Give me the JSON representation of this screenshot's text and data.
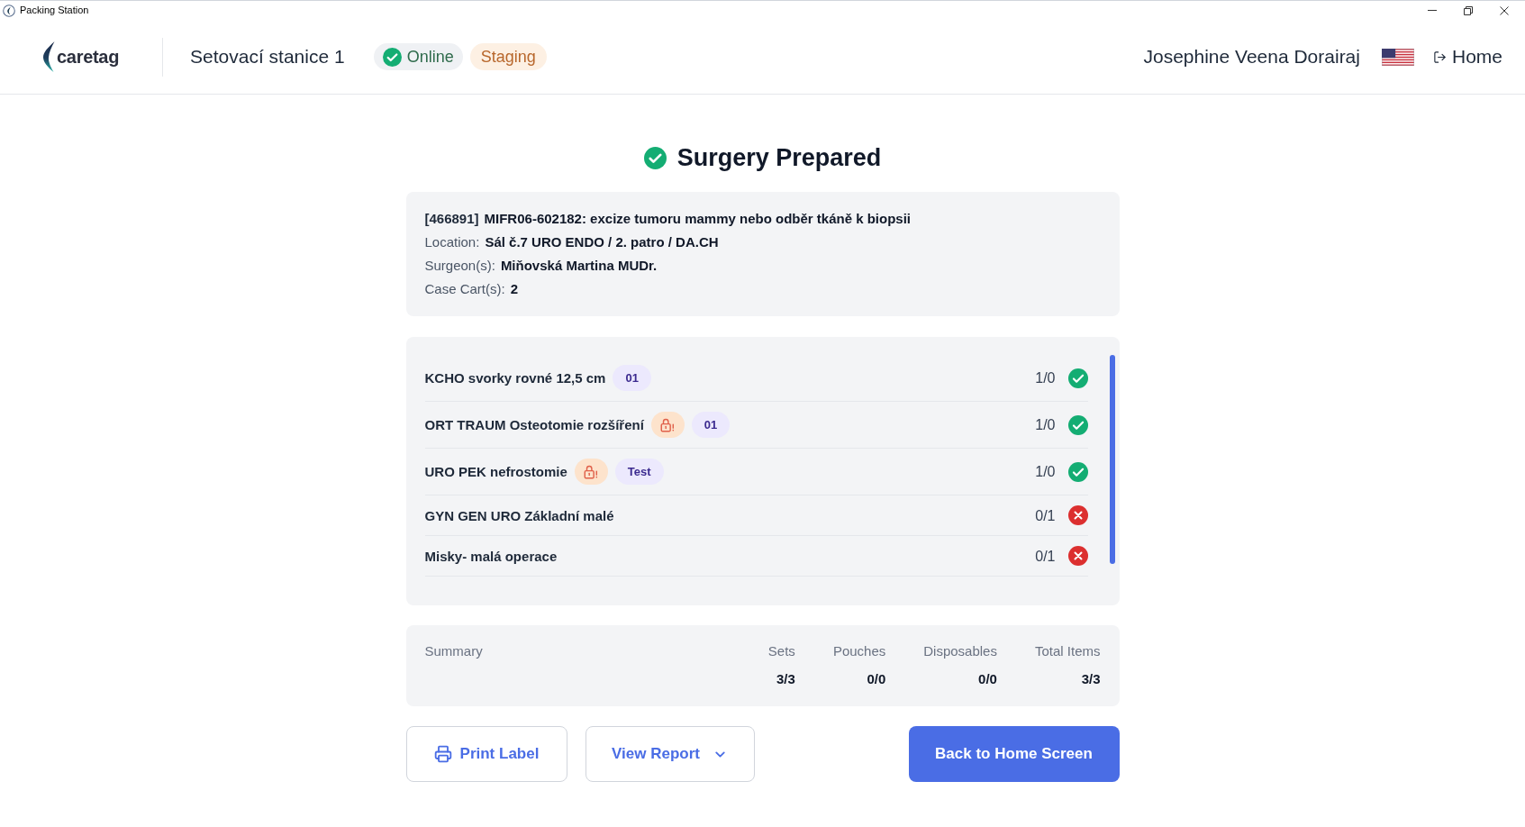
{
  "window": {
    "title": "Packing Station"
  },
  "header": {
    "logo": "caretag",
    "station": "Setovací stanice 1",
    "badges": [
      {
        "kind": "online",
        "label": "Online"
      },
      {
        "kind": "environment",
        "label": "Staging"
      }
    ],
    "user": "Josephine Veena Dorairaj",
    "home_link": "Home"
  },
  "heading": "Surgery Prepared",
  "case": {
    "id": "[466891]",
    "title": "MIFR06-602182: excize tumoru mammy nebo odběr tkáně k biopsii",
    "fields": [
      {
        "label": "Location:",
        "value": "Sál č.7 URO ENDO / 2. patro / DA.CH"
      },
      {
        "label": "Surgeon(s):",
        "value": "Miňovská Martina MUDr."
      },
      {
        "label": "Case Cart(s):",
        "value": "2"
      }
    ]
  },
  "items": [
    {
      "name": "KCHO svorky rovné 12,5 cm",
      "locked": false,
      "tag": "01",
      "count": "1/0",
      "complete": true
    },
    {
      "name": "ORT TRAUM Osteotomie rozšíření",
      "locked": true,
      "tag": "01",
      "count": "1/0",
      "complete": true
    },
    {
      "name": "URO PEK nefrostomie",
      "locked": true,
      "tag": "Test",
      "count": "1/0",
      "complete": true
    },
    {
      "name": "GYN GEN URO Základní malé",
      "locked": false,
      "count": "0/1",
      "complete": false
    },
    {
      "name": "Misky- malá operace",
      "locked": false,
      "count": "0/1",
      "complete": false
    }
  ],
  "summary": {
    "title": "Summary",
    "columns": [
      {
        "label": "Sets",
        "value": "3/3"
      },
      {
        "label": "Pouches",
        "value": "0/0"
      },
      {
        "label": "Disposables",
        "value": "0/0"
      },
      {
        "label": "Total Items",
        "value": "3/3"
      }
    ]
  },
  "buttons": [
    {
      "kind": "print",
      "label": "Print Label"
    },
    {
      "kind": "dropdown",
      "label": "View Report"
    },
    {
      "kind": "primary",
      "label": "Back to Home Screen"
    }
  ]
}
